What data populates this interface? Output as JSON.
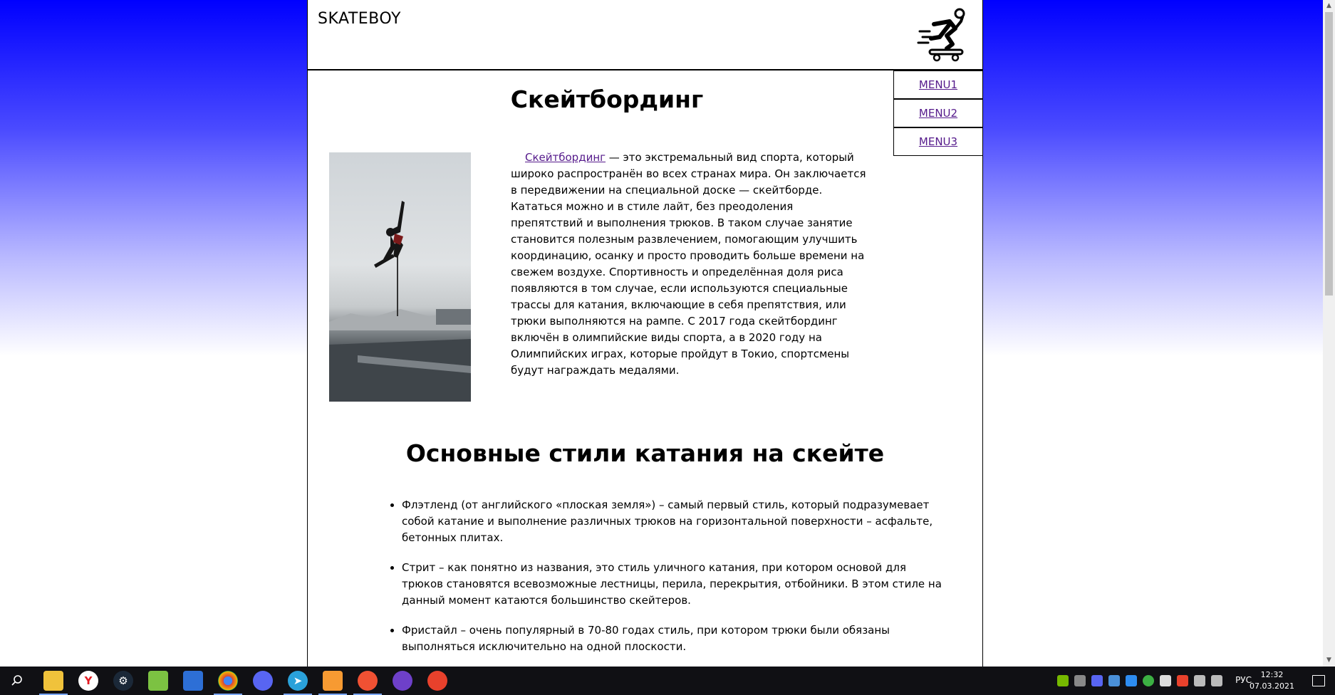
{
  "header": {
    "brand": "SKATEBOY",
    "logo_icon": "skateboarder-icon"
  },
  "menu": [
    "MENU1",
    "MENU2",
    "MENU3"
  ],
  "article": {
    "title": "Скейтбординг",
    "image_icon": "skateboarder-photo",
    "intro_link": "Скейтбординг",
    "intro_text": " — это экстремальный вид спорта, который широко распространён во всех странах мира. Он заключается в передвижении на специальной доске — скейтборде. Кататься можно и в стиле лайт, без преодоления препятствий и выполнения трюков. В таком случае занятие становится полезным развлечением, помогающим улучшить координацию, осанку и просто проводить больше времени на свежем воздухе. Спортивность и определённая доля риса появляются в том случае, если используются специальные трассы для катания, включающие в себя препятствия, или трюки выполняются на рампе. С 2017 года скейтбординг включён в олимпийские виды спорта, а в 2020 году на Олимпийских играх, которые пройдут в Токио, спортсмены будут награждать медалями."
  },
  "styles_section": {
    "title": "Основные стили катания на скейте",
    "items": [
      "Флэтленд (от английского «плоская земля») – самый первый стиль, который подразумевает собой катание и выполнение различных трюков на горизонтальной поверхности – асфальте, бетонных плитах.",
      "Стрит – как понятно из названия, это стиль уличного катания, при котором основой для трюков становятся всевозможные лестницы, перила, перекрытия, отбойники. В этом стиле на данный момент катаются большинство скейтеров.",
      "Фристайл – очень популярный в 70-80 годах стиль, при котором трюки были обязаны выполняться исключительно на одной плоскости."
    ]
  },
  "taskbar": {
    "apps": [
      "search-icon",
      "file-explorer-icon",
      "yandex-browser-icon",
      "steam-icon",
      "notepad-icon",
      "jetbrains-icon",
      "chrome-icon",
      "discord-icon",
      "telegram-icon",
      "sublime-text-icon",
      "git-icon",
      "github-desktop-icon",
      "app-icon"
    ],
    "language": "РУС",
    "time": "12:32",
    "date": "07.03.2021"
  },
  "colors": {
    "link": "#551a8b",
    "background_top": "#0000ff",
    "taskbar": "#101014"
  }
}
